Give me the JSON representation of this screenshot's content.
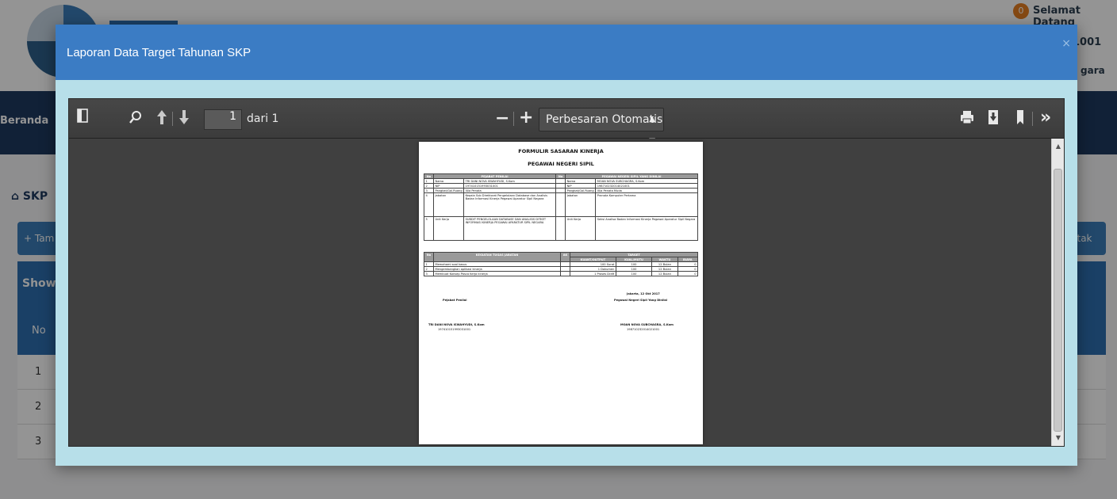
{
  "background": {
    "badge": "0",
    "welcome": "Selamat Datang",
    "user_id": "1001",
    "org": "gara",
    "nav_home": "Beranda",
    "breadcrumb": "SKP",
    "add_button": "+ Tam",
    "print_button": "tak",
    "show_label": "Show",
    "table_header_no": "No",
    "rows": [
      "1",
      "2",
      "3"
    ]
  },
  "modal": {
    "title": "Laporan Data Target Tahunan SKP",
    "close": "×"
  },
  "viewer": {
    "page_number": "1",
    "page_of": "dari 1",
    "zoom": "Perbesaran Otomatis",
    "zoom_out": "−",
    "zoom_in": "+",
    "icons": [
      "sidebar-toggle-icon",
      "search-icon",
      "up-arrow-icon",
      "down-arrow-icon",
      "print-icon",
      "download-icon",
      "bookmark-icon",
      "more-icon"
    ]
  },
  "document": {
    "title": "FORMULIR SASARAN KINERJA",
    "subtitle": "PEGAWAI NEGERI SIPIL",
    "officer_header": "PEJABAT PENILAI",
    "employee_header": "PEGAWAI NEGERI SIPIL YANG DINILAI",
    "col_no": "No",
    "rows": [
      {
        "no": "1",
        "label": "Nama",
        "left": "TRI DANI NOVA ISWAHYUDI, S.Kom",
        "right_label": "Nama",
        "right": "MOAN NOVA SUBCHAGRA, S.Kom"
      },
      {
        "no": "2",
        "label": "NIP",
        "left": "197410151993031001",
        "right_label": "NIP",
        "right": "198710232014021001"
      },
      {
        "no": "3",
        "label": "Pangkat/Gol.Ruang",
        "left": "III/a Penata",
        "right_label": "Pangkat/Gol.Ruang",
        "right": "III/a Penata Muda"
      },
      {
        "no": "4",
        "label": "Jabatan",
        "left": "Kepala Sub Direktorat Pengelolaan Database dan Analisis Badan Informasi Kinerja Pegawai Aparatur Sipil Negara",
        "right_label": "Jabatan",
        "right": "Pranata Komputer Pertama"
      },
      {
        "no": "5",
        "label": "Unit Kerja",
        "left": "SUBDIT PENGELOLAAN DATABASE DAN ANALISIS DITKET INFORMASI KINERJA PEGAWAI APARATUR SIPIL NEGARA",
        "right_label": "Unit Kerja",
        "right": "Seksi Analisa Badan Informasi Kinerja Pegawai Aparatur Sipil Negara"
      }
    ],
    "activity_header": "KEGIATAN TUGAS JABATAN",
    "ak_header": "AK",
    "target_header": "TARGET",
    "target_cols": [
      "KUANT/OUTPUT",
      "KUAL/MUTU",
      "WAKTU",
      "BIAYA"
    ],
    "activities": [
      {
        "no": "1",
        "name": "Memahami soal kasus",
        "output": "100 Surat",
        "quality": "100",
        "time": "12 Bulan",
        "cost": "0"
      },
      {
        "no": "2",
        "name": "Mengembangkan aplikasi kinerja",
        "output": "1 Dokumen",
        "quality": "100",
        "time": "12 Bulan",
        "cost": "0"
      },
      {
        "no": "3",
        "name": "Membuat Konsep Pasca Kerja kinerja",
        "output": "1 Proses Draft",
        "quality": "100",
        "time": "12 Bulan",
        "cost": "0"
      }
    ],
    "place_date": "Jakarta, 12 Okt 2017",
    "left_sig_role": "Pejabat Penilai",
    "right_sig_role": "Pegawai Negeri Sipil Yang Dinilai",
    "left_sig_name": "TRI DANI NOVA ISWAHYUDI, S.Kom",
    "left_sig_nip": "197410151993031001",
    "right_sig_name": "MOAN NOVA SUBCHAGRA, S.Kom",
    "right_sig_nip": "198710232014021001"
  }
}
